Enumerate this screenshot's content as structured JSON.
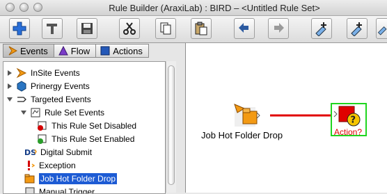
{
  "window": {
    "title": "Rule Builder (AraxiLab) : BIRD – <Untitled Rule Set>"
  },
  "toolbar": {
    "buttons": [
      {
        "icon": "add-icon"
      },
      {
        "icon": "hammer-icon"
      },
      {
        "icon": "save-icon"
      },
      {
        "icon": "cut-icon"
      },
      {
        "icon": "copy-icon"
      },
      {
        "icon": "paste-icon"
      },
      {
        "icon": "undo-icon"
      },
      {
        "icon": "redo-icon"
      },
      {
        "icon": "add-event-icon"
      },
      {
        "icon": "add-action-icon"
      },
      {
        "icon": "add-more-icon"
      }
    ]
  },
  "tabs": [
    {
      "label": "Events",
      "icon": "events-icon",
      "active": true
    },
    {
      "label": "Flow",
      "icon": "flow-icon",
      "active": false
    },
    {
      "label": "Actions",
      "icon": "actions-icon",
      "active": false
    }
  ],
  "tree": [
    {
      "label": "InSite Events",
      "disclosure": "collapsed",
      "icon": "insite-icon"
    },
    {
      "label": "Prinergy Events",
      "disclosure": "collapsed",
      "icon": "prinergy-icon"
    },
    {
      "label": "Targeted Events",
      "disclosure": "expanded",
      "icon": "targeted-icon"
    },
    {
      "label": "Rule Set Events",
      "disclosure": "expanded",
      "icon": "rule-set-icon"
    },
    {
      "label": "This Rule Set Disabled",
      "disclosure": "none",
      "icon": "rule-set-disabled-icon"
    },
    {
      "label": "This Rule Set Enabled",
      "disclosure": "none",
      "icon": "rule-set-enabled-icon"
    },
    {
      "label": "Digital Submit",
      "disclosure": "none",
      "icon": "digital-submit-icon"
    },
    {
      "label": "Exception",
      "disclosure": "none",
      "icon": "exception-icon"
    },
    {
      "label": "Job Hot Folder Drop",
      "disclosure": "none",
      "icon": "hot-folder-icon",
      "selected": true
    },
    {
      "label": "Manual Trigger",
      "disclosure": "none",
      "icon": "manual-trigger-icon"
    }
  ],
  "canvas": {
    "event_node": {
      "label": "Job Hot Folder Drop"
    },
    "action_node": {
      "label": "Action?"
    },
    "colors": {
      "connector": "#e00000",
      "action_border": "#1fd51f",
      "action_label": "#e00000",
      "selection": "#1d5bd4"
    }
  }
}
